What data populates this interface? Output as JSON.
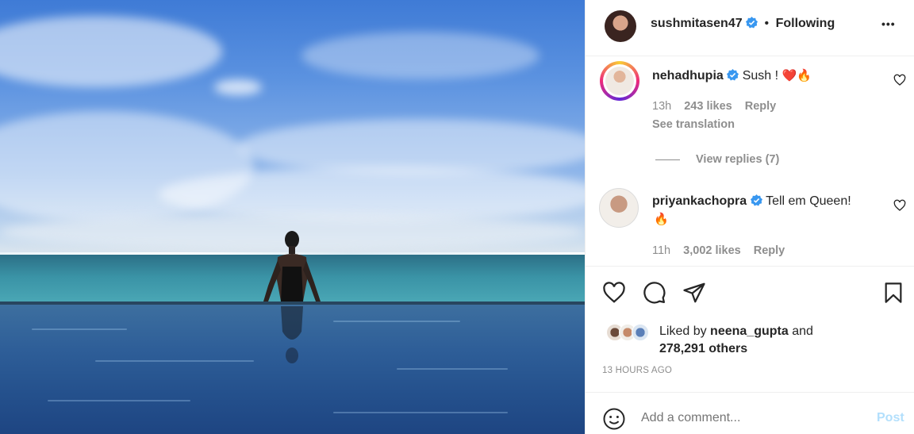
{
  "post": {
    "author": "sushmitasen47",
    "follow_separator": "•",
    "follow_state": "Following",
    "more_label": "•••"
  },
  "comments": [
    {
      "username": "nehadhupia",
      "text": "Sush !",
      "emoji": "❤️🔥",
      "time": "13h",
      "likes": "243 likes",
      "reply": "Reply",
      "translate": "See translation",
      "view_replies": "View replies (7)"
    },
    {
      "username": "priyankachopra",
      "text": "Tell em Queen!",
      "emoji": "🔥",
      "time": "11h",
      "likes": "3,002 likes",
      "reply": "Reply"
    }
  ],
  "likes": {
    "prefix": "Liked by",
    "user": "neena_gupta",
    "conj": "and",
    "others": "278,291 others"
  },
  "timestamp": "13 HOURS AGO",
  "composer": {
    "placeholder": "Add a comment...",
    "post_label": "Post"
  },
  "colors": {
    "verified": "#3897f0",
    "post_disabled": "#b2dffc",
    "muted": "#8e8e8e",
    "heart_red": "#ed4956"
  },
  "icons": [
    "verified-badge-icon",
    "more-options-icon",
    "heart-icon",
    "comment-icon",
    "share-icon",
    "bookmark-icon",
    "emoji-icon"
  ]
}
